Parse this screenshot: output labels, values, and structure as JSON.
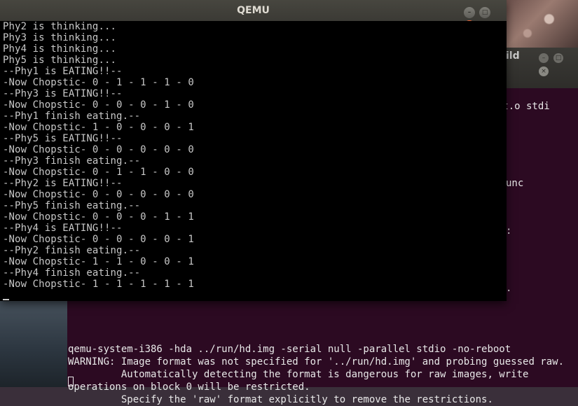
{
  "qemu": {
    "title": "QEMU",
    "controls": {
      "minimize": "–",
      "maximize": "□",
      "close": "×"
    },
    "lines": [
      "Phy2 is thinking...",
      "Phy3 is thinking...",
      "Phy4 is thinking...",
      "Phy5 is thinking...",
      "--Phy1 is EATING!!--",
      "-Now Chopstic- 0 - 1 - 1 - 1 - 0",
      "--Phy3 is EATING!!--",
      "-Now Chopstic- 0 - 0 - 0 - 1 - 0",
      "--Phy1 finish eating.--",
      "-Now Chopstic- 1 - 0 - 0 - 0 - 1",
      "--Phy5 is EATING!!--",
      "-Now Chopstic- 0 - 0 - 0 - 0 - 0",
      "--Phy3 finish eating.--",
      "-Now Chopstic- 0 - 1 - 1 - 0 - 0",
      "--Phy2 is EATING!!--",
      "-Now Chopstic- 0 - 0 - 0 - 0 - 0",
      "--Phy5 finish eating.--",
      "-Now Chopstic- 0 - 0 - 0 - 1 - 1",
      "--Phy4 is EATING!!--",
      "-Now Chopstic- 0 - 0 - 0 - 0 - 1",
      "--Phy2 finish eating.--",
      "-Now Chopstic- 1 - 1 - 0 - 0 - 1",
      "--Phy4 finish eating.--",
      "-Now Chopstic- 1 - 1 - 1 - 1 - 1"
    ]
  },
  "terminal": {
    "title_fragment": "ild",
    "fragments": {
      "line1": "rupt.o stdi",
      "line2": "unc",
      "line3": ":",
      "line4": "."
    },
    "lines": [
      "qemu-system-i386 -hda ../run/hd.img -serial null -parallel stdio -no-reboot",
      "WARNING: Image format was not specified for '../run/hd.img' and probing guessed raw.",
      "         Automatically detecting the format is dangerous for raw images, write operations on block 0 will be restricted.",
      "         Specify the 'raw' format explicitly to remove the restrictions."
    ]
  },
  "colors": {
    "terminal_bg": "#2c0a22",
    "vga_text": "#c8c8c8",
    "close_button": "#e85a2a"
  }
}
